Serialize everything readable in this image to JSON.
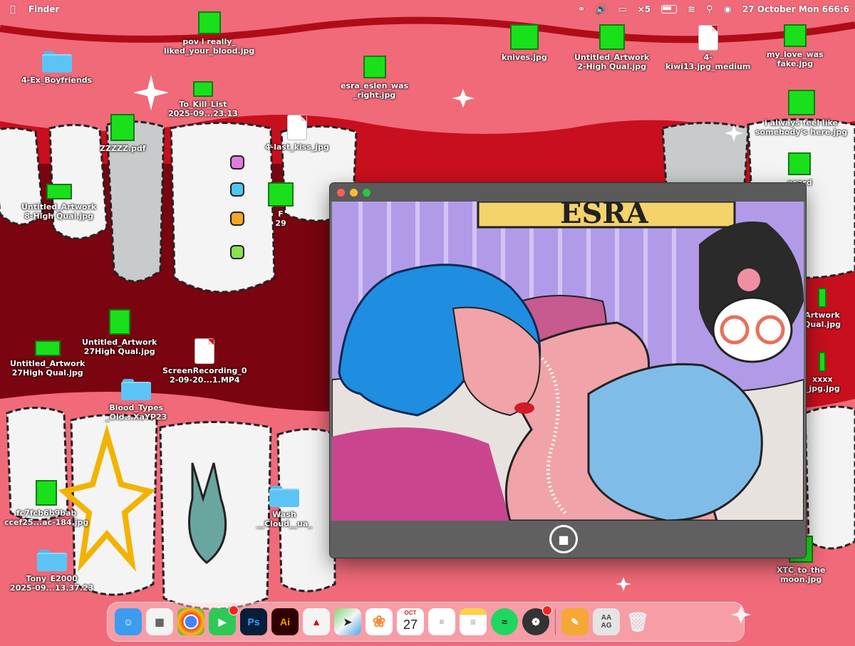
{
  "menubar": {
    "apple_icon": "apple-icon",
    "app_name": "Finder",
    "status_icons": [
      "creative-cloud-icon",
      "volume-icon",
      "screen-mirroring-icon",
      "vpn-icon",
      "battery-icon",
      "wifi-icon",
      "search-icon",
      "control-center-icon"
    ],
    "vpn_label": "×5",
    "clock": "27 October Mon 666:6"
  },
  "desktop_icons": [
    {
      "id": "pov",
      "type": "image",
      "label": "pov i really_\nliked_your_blood.jpg"
    },
    {
      "id": "ex-boyfriends",
      "type": "folder",
      "label": "4-Ex_Boyfriends"
    },
    {
      "id": "to-kill-list",
      "type": "image",
      "label": "To_Kill_List\n2025-09...23.13"
    },
    {
      "id": "esra",
      "type": "image",
      "label": "esra_eslen_was\n_right.jpg"
    },
    {
      "id": "knives",
      "type": "image",
      "label": "knives.jpg"
    },
    {
      "id": "untitled-hq-top",
      "type": "image",
      "label": "Untitled_Artwork\n2-High Qual.jpg"
    },
    {
      "id": "kiwi",
      "type": "document",
      "label": "4-\nkiwi13.jpg_medium"
    },
    {
      "id": "my-love",
      "type": "image",
      "label": "my_love_was\nfake.jpg"
    },
    {
      "id": "always-feel",
      "type": "image",
      "label": "i always feel like\nsomebody's here.jpg"
    },
    {
      "id": "zzzzz",
      "type": "image",
      "label": "ZZZZZ.pdf"
    },
    {
      "id": "last-kiss",
      "type": "document",
      "label": "4-last_kiss_jpg"
    },
    {
      "id": "untitled-8",
      "type": "image",
      "label": "Untitled_Artwork\n8-High Qual.jpg"
    },
    {
      "id": "f-29",
      "type": "image",
      "label": "F\n29"
    },
    {
      "id": "untitled-27a",
      "type": "image",
      "label": "Untitled_Artwork\n27High Qual.jpg"
    },
    {
      "id": "untitled-27b",
      "type": "image",
      "label": "Untitled_Artwork\n27High Qual.jpg"
    },
    {
      "id": "screen-recording",
      "type": "document",
      "label": "ScreenRecording_0\n2-09-20...1.MP4"
    },
    {
      "id": "blood-types",
      "type": "folder",
      "label": "Blood_Types\n_Old...XaYP23"
    },
    {
      "id": "fc7",
      "type": "image",
      "label": "fc7fcb6b9bab\nccef25...ac-184.jpg"
    },
    {
      "id": "tony",
      "type": "folder",
      "label": "Tony_E2000\n2025-09...13.37.23"
    },
    {
      "id": "folder-wash",
      "type": "folder",
      "label": "Wash\n__Cloud__ua_"
    },
    {
      "id": "right-artwork",
      "type": "image",
      "label": "Artwork\nQual.jpg"
    },
    {
      "id": "right-xxxx",
      "type": "image",
      "label": "xxxx\n_jpg.jpg"
    },
    {
      "id": "right-word",
      "type": "image",
      "label": "ecard"
    },
    {
      "id": "xtc",
      "type": "image",
      "label": "XTC_to_the\nmoon.jpg"
    }
  ],
  "window": {
    "title": "",
    "controls": [
      "close",
      "minimize",
      "zoom"
    ],
    "banner_text": "ESRA",
    "record_icon": "video-camera-icon"
  },
  "dock": {
    "apps": [
      {
        "name": "Finder",
        "icon": "finder-icon"
      },
      {
        "name": "Launchpad",
        "icon": "launchpad-icon"
      },
      {
        "name": "Google Chrome",
        "icon": "chrome-icon"
      },
      {
        "name": "FaceTime",
        "icon": "facetime-icon",
        "badge": true
      },
      {
        "name": "Photoshop",
        "icon": "photoshop-icon",
        "text": "Ps"
      },
      {
        "name": "Illustrator",
        "icon": "illustrator-icon",
        "text": "Ai"
      },
      {
        "name": "Acrobat",
        "icon": "acrobat-icon"
      },
      {
        "name": "Maps",
        "icon": "maps-icon"
      },
      {
        "name": "Photos",
        "icon": "photos-icon"
      },
      {
        "name": "Calendar",
        "icon": "calendar-icon",
        "month": "OCT",
        "day": "27"
      },
      {
        "name": "Reminders",
        "icon": "reminders-icon"
      },
      {
        "name": "Notes",
        "icon": "notes-icon"
      },
      {
        "name": "Spotify",
        "icon": "spotify-icon"
      },
      {
        "name": "Aperture",
        "icon": "aperture-icon",
        "badge": true
      },
      {
        "name": "Pages",
        "icon": "pages-icon"
      },
      {
        "name": "Font Book",
        "icon": "fontbook-icon",
        "text": "AA\nAG"
      },
      {
        "name": "Trash",
        "icon": "trash-icon"
      }
    ]
  },
  "colors": {
    "wallpaper_red": "#c80f1e",
    "gum_pink": "#f06a7a",
    "tooth_white": "#f4f4f4",
    "green_square": "#19e01b",
    "folder_blue": "#5cc4f5",
    "window_gray": "#6b6b6b"
  }
}
